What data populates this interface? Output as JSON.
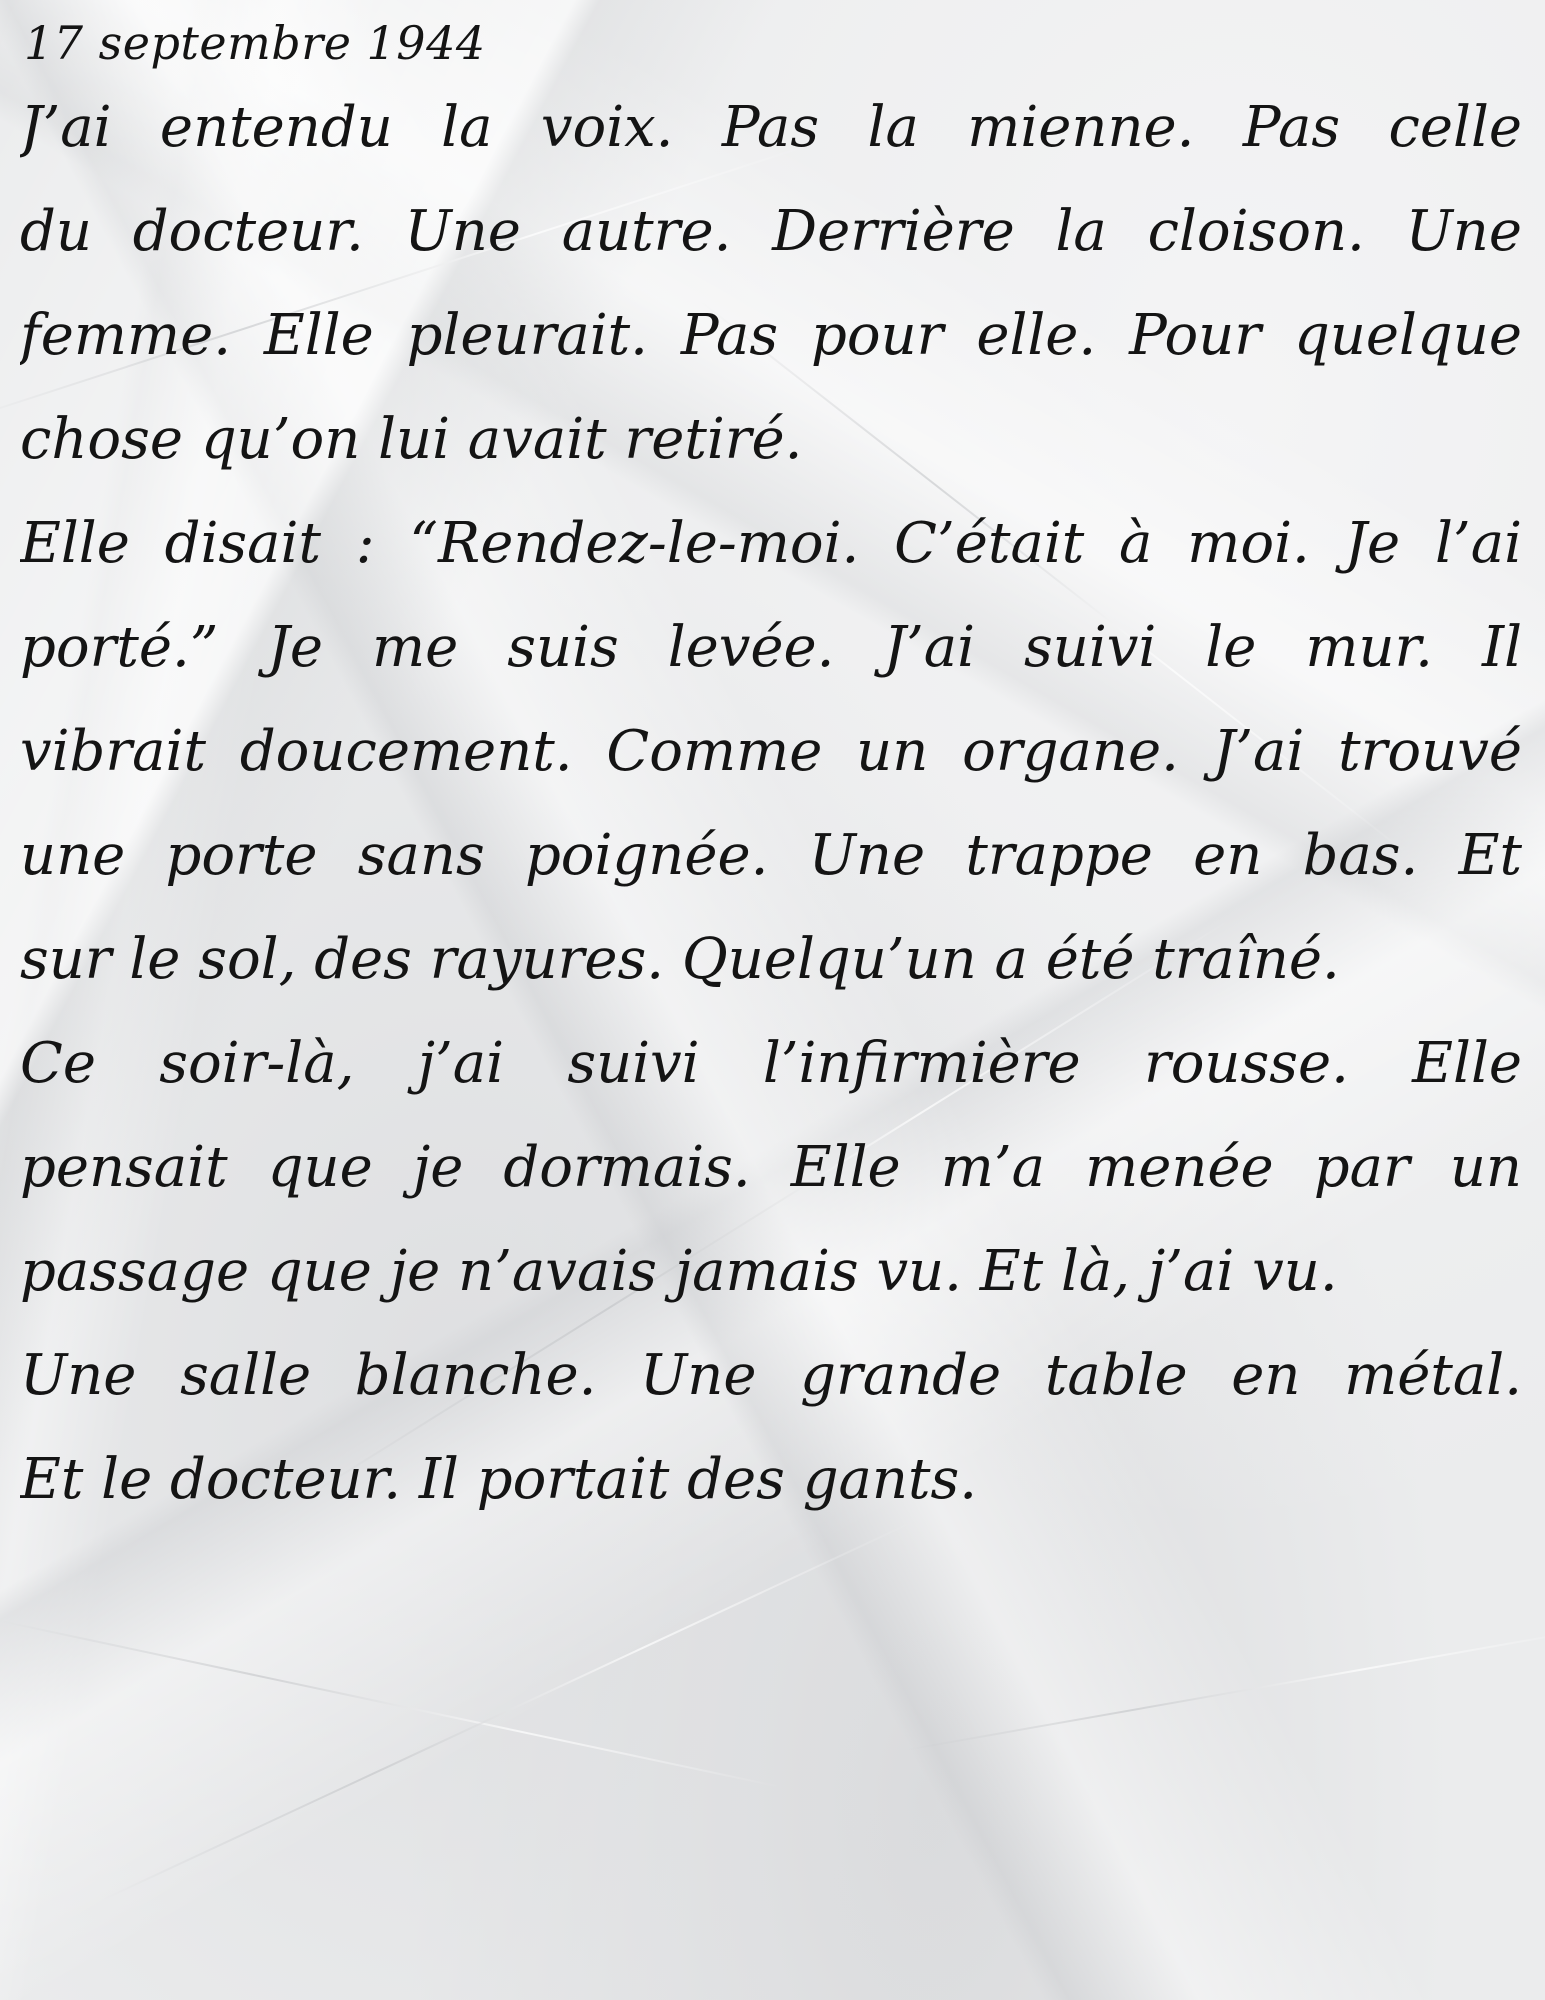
{
  "document": {
    "date": "17 septembre 1944",
    "lines": [
      "J’ai entendu la voix. Pas la mienne. Pas celle",
      "du docteur. Une autre. Derrière la cloison. Une",
      "femme. Elle pleurait. Pas pour elle. Pour quelque",
      "chose qu’on lui avait retiré.",
      "Elle disait : “Rendez-le-moi. C’était à moi. Je l’ai",
      "porté.” Je me suis levée. J’ai suivi le mur. Il",
      "vibrait doucement. Comme un organe. J’ai trouvé",
      "une porte sans poignée. Une trappe en bas. Et",
      "sur le sol, des rayures. Quelqu’un a été traîné.",
      "Ce soir-là, j’ai suivi l’infirmière rousse. Elle",
      "pensait que je dormais. Elle m’a menée par un",
      "passage que je n’avais jamais vu. Et là, j’ai vu.",
      "Une salle blanche. Une grande table en métal.",
      "Et le docteur. Il portait des gants."
    ]
  },
  "colors": {
    "ink": "#141414",
    "paper": "#ebeced"
  }
}
